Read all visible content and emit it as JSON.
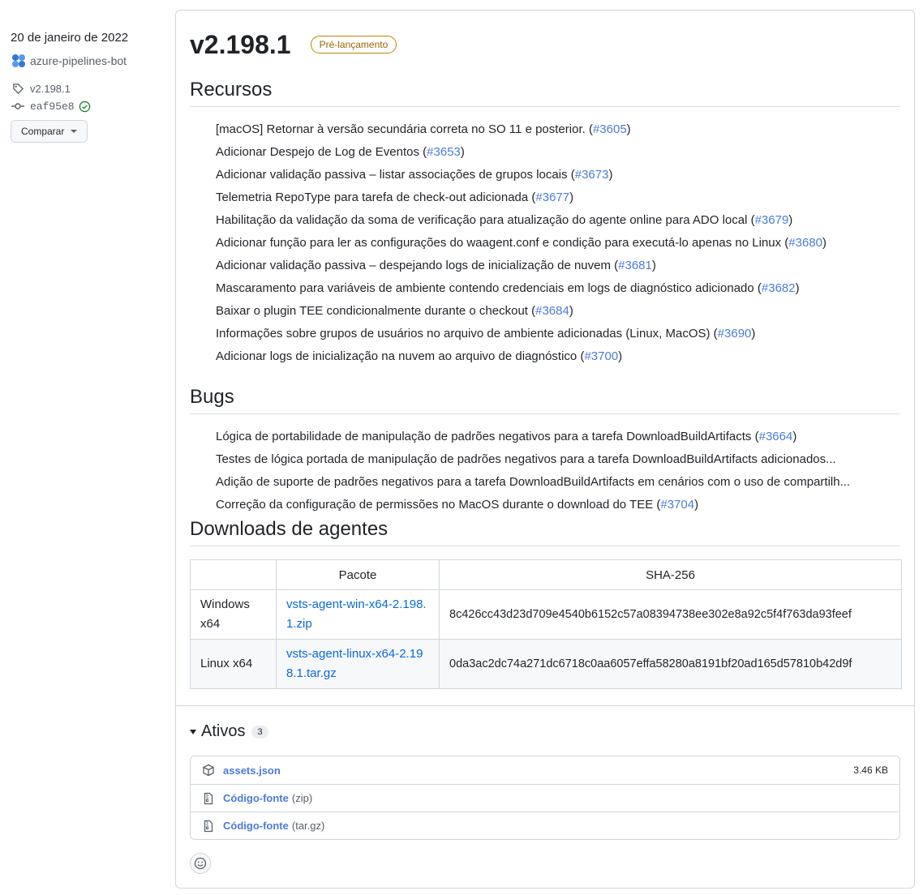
{
  "sidebar": {
    "date": "20 de janeiro de 2022",
    "author": "azure-pipelines-bot",
    "tag": "v2.198.1",
    "commit": "eaf95e8",
    "compare_label": "Comparar"
  },
  "release": {
    "title": "v2.198.1",
    "badge": "Pré-lançamento"
  },
  "features": {
    "heading": "Recursos",
    "items": [
      {
        "text": "[macOS] Retornar à versão secundária correta no SO 11 e posterior. (",
        "ref": "#3605",
        "end": ")"
      },
      {
        "text": "Adicionar Despejo de Log de Eventos (",
        "ref": "#3653",
        "end": ")"
      },
      {
        "text": "Adicionar validação passiva – listar associações de grupos locais (",
        "ref": "#3673",
        "end": ")"
      },
      {
        "text": "Telemetria RepoType para tarefa de check-out adicionada (",
        "ref": "#3677",
        "end": ")"
      },
      {
        "text": "Habilitação da validação da soma de verificação para atualização do agente online para ADO local (",
        "ref": "#3679",
        "end": ")"
      },
      {
        "text": "Adicionar função para ler as configurações do waagent.conf e condição para executá-lo apenas no Linux (",
        "ref": "#3680",
        "end": ")"
      },
      {
        "text": "Adicionar validação passiva – despejando logs de inicialização de nuvem (",
        "ref": "#3681",
        "end": ")"
      },
      {
        "text": "Mascaramento para variáveis de ambiente contendo credenciais em logs de diagnóstico adicionado (",
        "ref": "#3682",
        "end": ")"
      },
      {
        "text": "Baixar o plugin TEE condicionalmente durante o checkout (",
        "ref": "#3684",
        "end": ")"
      },
      {
        "text": "Informações sobre grupos de usuários no arquivo de ambiente adicionadas (Linux, MacOS) (",
        "ref": "#3690",
        "end": ")"
      },
      {
        "text": "Adicionar logs de inicialização na nuvem ao arquivo de diagnóstico (",
        "ref": "#3700",
        "end": ")"
      }
    ]
  },
  "bugs": {
    "heading": "Bugs",
    "items": [
      {
        "text": "Lógica de portabilidade de manipulação de padrões negativos para a tarefa DownloadBuildArtifacts (",
        "ref": "#3664",
        "end": ")"
      },
      {
        "text": "Testes de lógica portada de manipulação de padrões negativos para a tarefa DownloadBuildArtifacts adicionados...",
        "ref": "",
        "end": ""
      },
      {
        "text": "Adição de suporte de padrões negativos para a tarefa DownloadBuildArtifacts em cenários com o uso de compartilh...",
        "ref": "",
        "end": ""
      },
      {
        "text": "Correção da configuração de permissões no MacOS durante o download do TEE (",
        "ref": "#3704",
        "end": ")"
      }
    ]
  },
  "downloads": {
    "heading": "Downloads de agentes",
    "col_package": "Pacote",
    "col_sha": "SHA-256",
    "rows": [
      {
        "platform": "Windows x64",
        "file": "vsts-agent-win-x64-2.198.1.zip",
        "sha": "8c426cc43d23d709e4540b6152c57a08394738ee302e8a92c5f4f763da93feef"
      },
      {
        "platform": "Linux x64",
        "file": "vsts-agent-linux-x64-2.198.1.tar.gz",
        "sha": "0da3ac2dc74a271dc6718c0aa6057effa58280a8191bf20ad165d57810b42d9f"
      }
    ]
  },
  "assets": {
    "heading": "Ativos",
    "count": "3",
    "items": [
      {
        "name": "assets.json",
        "ext": "",
        "size": "3.46 KB",
        "icon": "package-icon"
      },
      {
        "name": "Código-fonte",
        "ext": "(zip)",
        "size": "",
        "icon": "file-zip-icon"
      },
      {
        "name": "Código-fonte",
        "ext": "(tar.gz)",
        "size": "",
        "icon": "file-zip-icon"
      }
    ]
  }
}
